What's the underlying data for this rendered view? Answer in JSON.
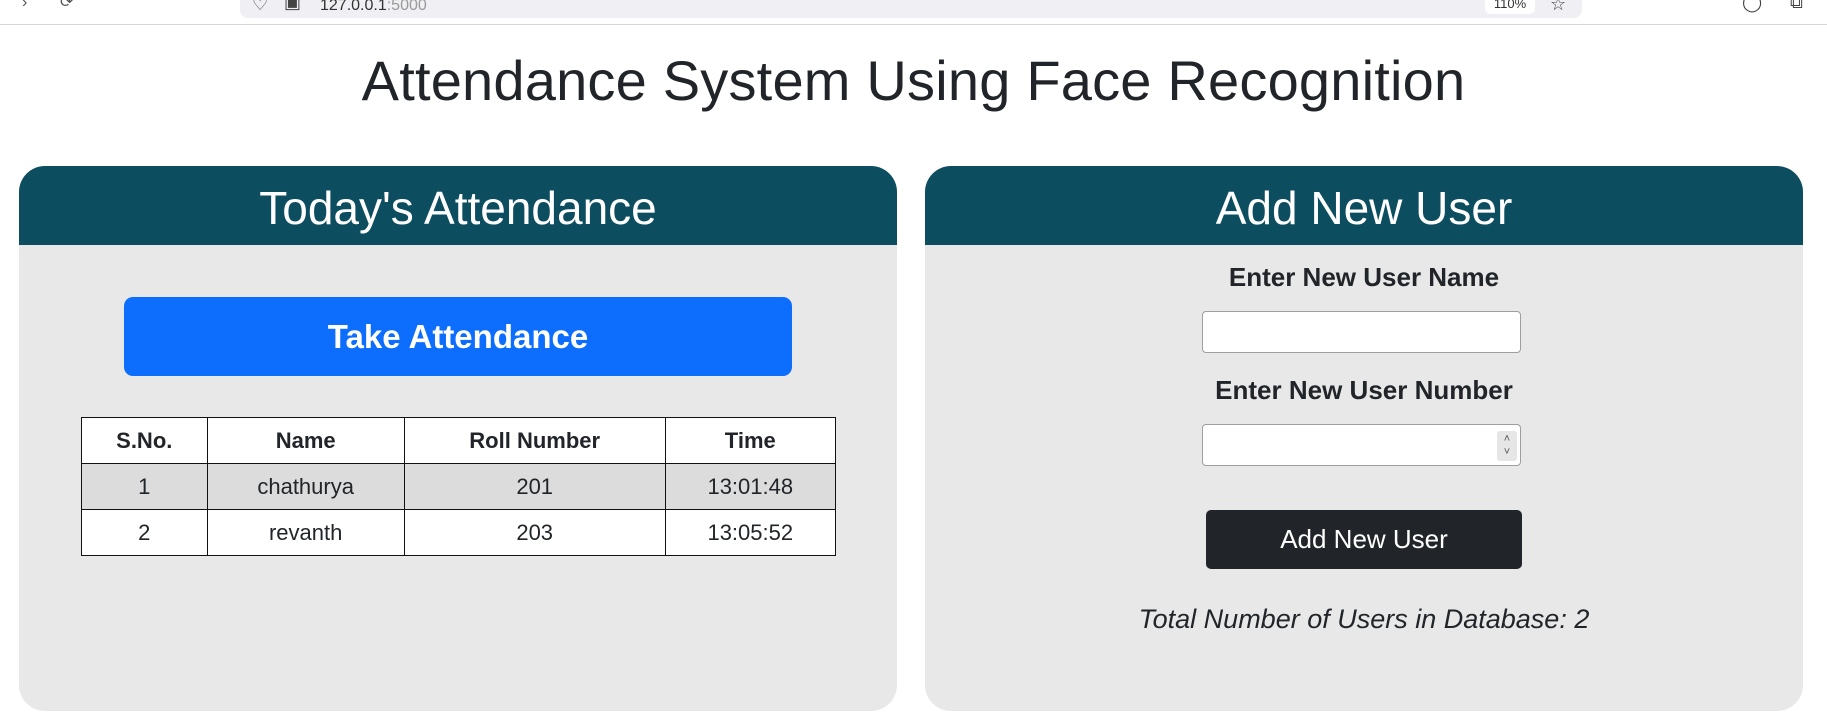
{
  "browser": {
    "url_host": "127.0.0.1",
    "url_port": ":5000",
    "zoom": "110%"
  },
  "page": {
    "title": "Attendance System Using Face Recognition"
  },
  "attendance": {
    "header": "Today's Attendance",
    "take_button": "Take Attendance",
    "columns": [
      "S.No.",
      "Name",
      "Roll Number",
      "Time"
    ],
    "rows": [
      [
        "1",
        "chathurya",
        "201",
        "13:01:48"
      ],
      [
        "2",
        "revanth",
        "203",
        "13:05:52"
      ]
    ]
  },
  "add_user": {
    "header": "Add New User",
    "name_label": "Enter New User Name",
    "name_value": "",
    "number_label": "Enter New User Number",
    "number_value": "",
    "submit_label": "Add New User",
    "total_text": "Total Number of Users in Database: 2"
  },
  "colors": {
    "header_bg": "#0d4d60",
    "card_bg": "#e8e8e8",
    "primary_button": "#0d6efd",
    "dark_button": "#212529"
  }
}
